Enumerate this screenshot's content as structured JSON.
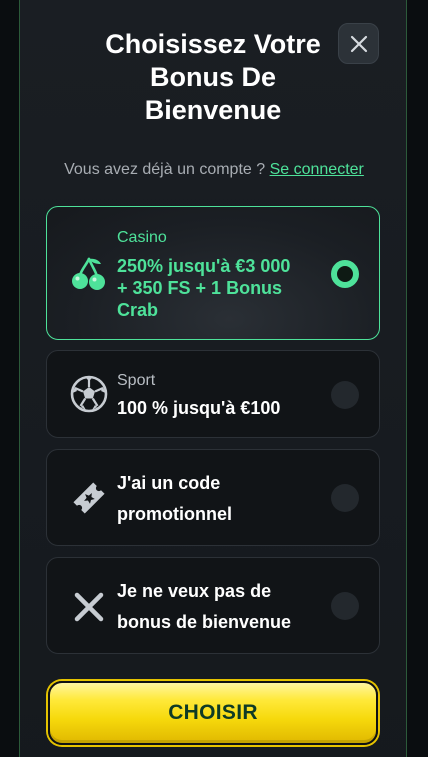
{
  "modal": {
    "title_line1": "Choisissez Votre",
    "title_line2": "Bonus De",
    "title_line3": "Bienvenue",
    "close_icon": "close-icon",
    "login_prompt": "Vous avez déjà un compte ?",
    "login_link": "Se connecter"
  },
  "options": [
    {
      "id": "casino",
      "icon": "cherries-icon",
      "subtitle": "Casino",
      "title_line1": "250% jusqu'à €3 000",
      "title_line2": "+ 350 FS + 1 Bonus",
      "title_line3": "Crab",
      "selected": true
    },
    {
      "id": "sport",
      "icon": "soccer-ball-icon",
      "subtitle": "Sport",
      "title_line1": "100 % jusqu'à €100",
      "selected": false
    },
    {
      "id": "promo-code",
      "icon": "ticket-icon",
      "title_line1": "J'ai un code",
      "title_line2": "promotionnel",
      "selected": false
    },
    {
      "id": "no-bonus",
      "icon": "x-icon",
      "title_line1": "Je ne veux pas de",
      "title_line2": "bonus de bienvenue",
      "selected": false
    }
  ],
  "choose_button": {
    "label": "CHOISIR"
  },
  "colors": {
    "accent": "#4ee29a",
    "button": "#f6d90c",
    "background": "#1a1e23"
  }
}
